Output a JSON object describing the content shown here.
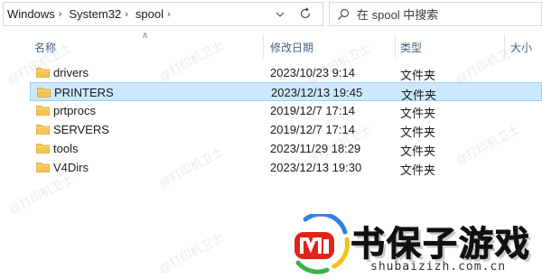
{
  "address_bar": {
    "breadcrumbs": [
      "Windows",
      "System32",
      "spool"
    ],
    "dropdown_icon": "chevron-down-icon",
    "refresh_icon": "refresh-icon"
  },
  "search": {
    "placeholder": "在 spool 中搜索"
  },
  "columns": {
    "name": "名称",
    "modified": "修改日期",
    "type": "类型",
    "size": "大小"
  },
  "files": [
    {
      "name": "drivers",
      "modified": "2023/10/23 9:14",
      "type": "文件夹",
      "selected": false
    },
    {
      "name": "PRINTERS",
      "modified": "2023/12/13 19:45",
      "type": "文件夹",
      "selected": true
    },
    {
      "name": "prtprocs",
      "modified": "2019/12/7 17:14",
      "type": "文件夹",
      "selected": false
    },
    {
      "name": "SERVERS",
      "modified": "2019/12/7 17:14",
      "type": "文件夹",
      "selected": false
    },
    {
      "name": "tools",
      "modified": "2023/11/29 18:29",
      "type": "文件夹",
      "selected": false
    },
    {
      "name": "V4Dirs",
      "modified": "2023/12/13 19:30",
      "type": "文件夹",
      "selected": false
    }
  ],
  "watermark_text": "@打印机卫士",
  "logo": {
    "title": "书保子游戏",
    "url": "shubaizizh.com.cn"
  },
  "colors": {
    "selection_bg": "#cce8ff",
    "selection_border": "#99d1ff",
    "folder": "#f6c454",
    "header_text": "#4c607a"
  }
}
